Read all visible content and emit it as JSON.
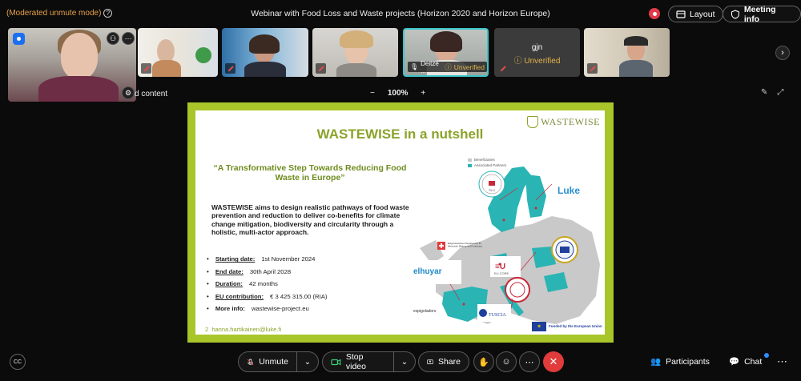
{
  "window": {
    "mode_label": "(Moderated unmute mode)",
    "meeting_title": "Webinar with Food Loss and Waste projects (Horizon 2020 and Horizon Europe)",
    "layout_label": "Layout",
    "meeting_info_label": "Meeting info"
  },
  "participants": {
    "tile_deitze_name": "Deitze ...",
    "tile_deitze_status": "Unverified",
    "tile_gjn_name": "gjn",
    "tile_gjn_status": "Unverified"
  },
  "share": {
    "label": "d content",
    "zoom_level": "100%",
    "zoom_minus": "−",
    "zoom_plus": "+"
  },
  "slide": {
    "title": "WASTEWISE in a nutshell",
    "logo_text": "WASTEWISE",
    "quote": "“A Transformative Step Towards Reducing Food Waste in Europe”",
    "description": "WASTEWISE aims to design realistic pathways of food waste prevention and reduction to deliver co-benefits for climate change mitigation, biodiversity and circularity through a holistic, multi-actor approach.",
    "facts": [
      {
        "key": "Starting date:",
        "value": " 1st November 2024"
      },
      {
        "key": "End date:",
        "value": " 30th April 2028"
      },
      {
        "key": "Duration:",
        "value": " 42 months"
      },
      {
        "key": "EU contribution:",
        "value": " € 3 425 315.00 (RIA)"
      },
      {
        "key": "More info:",
        "value": " wastewise-project.eu"
      }
    ],
    "email": "hanna.hartikainen@luke.fi",
    "legend_beneficiaries": "Beneficiaries",
    "legend_associated": "Associated Partners",
    "partner_slu": "SLU",
    "partner_luke": "Luke",
    "partner_elhuyar": "elhuyar",
    "partner_eucore": "EU CORE",
    "partner_tuscia": "TUSCIA",
    "partner_espigoladors": "espigoladors",
    "funded_by": "Funded by the European Union",
    "page_number": "2"
  },
  "controls": {
    "unmute": "Unmute",
    "stop_video": "Stop video",
    "share": "Share",
    "participants": "Participants",
    "chat": "Chat"
  },
  "colors": {
    "accent_green": "#8aa32a",
    "slide_border": "#a8c52a",
    "map_teal": "#2bb4b4",
    "warning": "#e3b44a",
    "leave_red": "#e23b3b"
  }
}
